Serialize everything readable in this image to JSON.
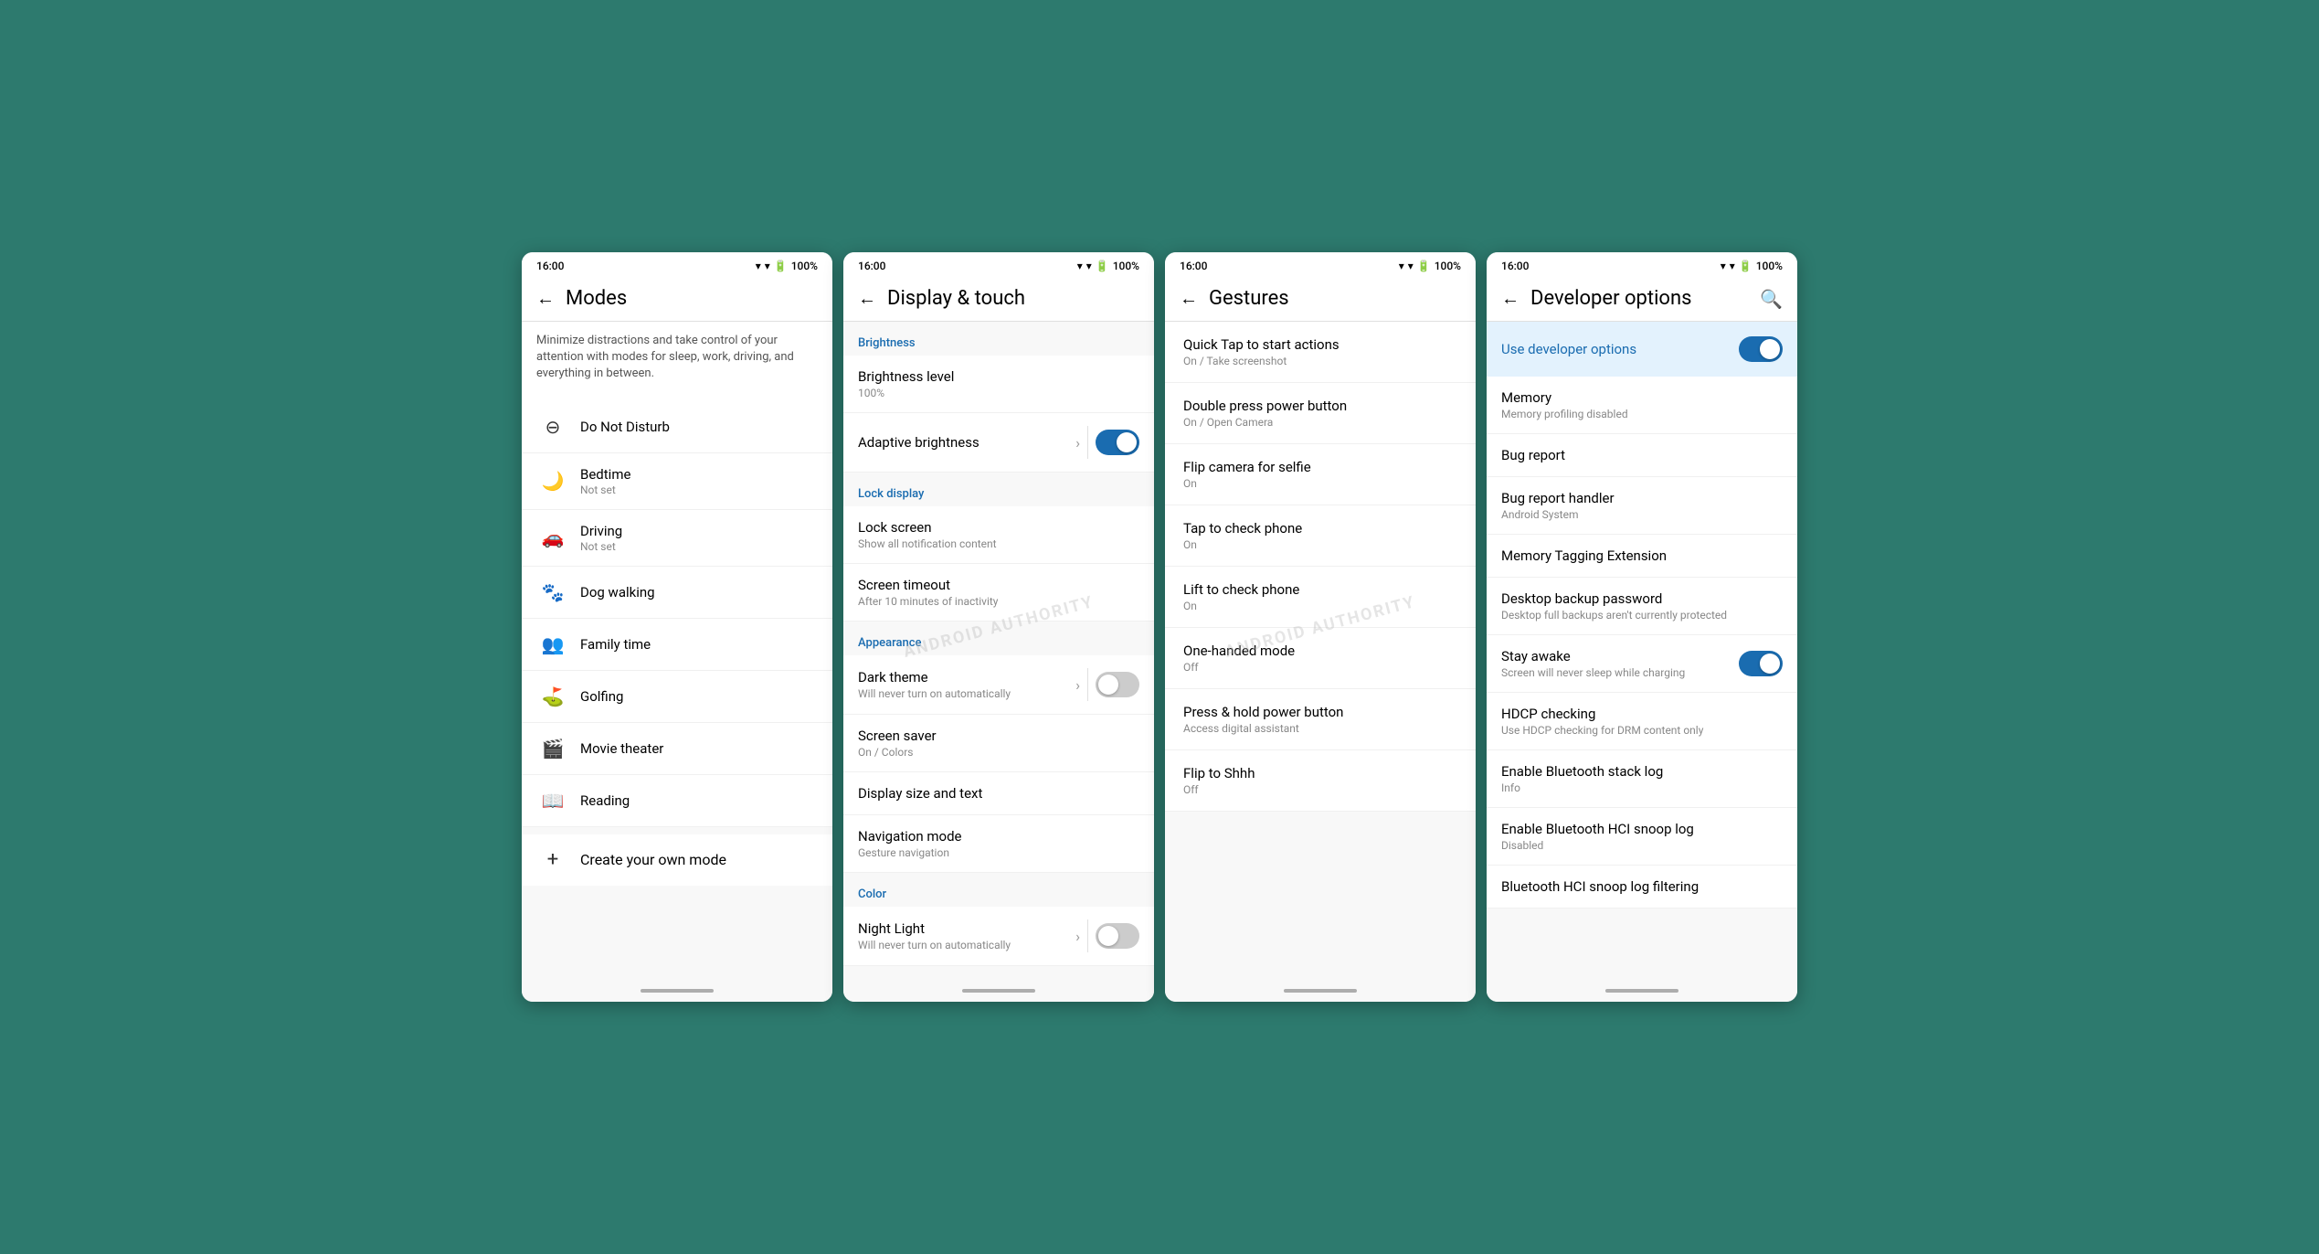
{
  "screens": [
    {
      "id": "modes",
      "statusBar": {
        "time": "16:00",
        "battery": "100%",
        "hasWifi": true,
        "hasBattery": true
      },
      "header": {
        "title": "Modes",
        "hasBack": true,
        "hasSearch": false
      },
      "description": "Minimize distractions and take control of your attention with modes for sleep, work, driving, and everything in between.",
      "modes": [
        {
          "icon": "⊖",
          "name": "Do Not Disturb",
          "sub": ""
        },
        {
          "icon": "🌙",
          "name": "Bedtime",
          "sub": "Not set"
        },
        {
          "icon": "🚗",
          "name": "Driving",
          "sub": "Not set"
        },
        {
          "icon": "🐾",
          "name": "Dog walking",
          "sub": ""
        },
        {
          "icon": "👥",
          "name": "Family time",
          "sub": ""
        },
        {
          "icon": "⛳",
          "name": "Golfing",
          "sub": ""
        },
        {
          "icon": "🎬",
          "name": "Movie theater",
          "sub": ""
        },
        {
          "icon": "📖",
          "name": "Reading",
          "sub": ""
        }
      ],
      "createMode": {
        "icon": "+",
        "label": "Create your own mode"
      }
    },
    {
      "id": "display-touch",
      "statusBar": {
        "time": "16:00",
        "battery": "100%",
        "hasWifi": true,
        "hasBattery": true
      },
      "header": {
        "title": "Display & touch",
        "hasBack": true
      },
      "sections": [
        {
          "label": "Brightness",
          "items": [
            {
              "name": "Brightness level",
              "sub": "100%",
              "hasToggle": false,
              "hasChevron": false,
              "toggleOn": false,
              "hasSlider": false
            },
            {
              "name": "Adaptive brightness",
              "sub": "",
              "hasToggle": true,
              "hasChevron": true,
              "toggleOn": true
            }
          ]
        },
        {
          "label": "Lock display",
          "items": [
            {
              "name": "Lock screen",
              "sub": "Show all notification content",
              "hasToggle": false,
              "hasChevron": false
            },
            {
              "name": "Screen timeout",
              "sub": "After 10 minutes of inactivity",
              "hasToggle": false,
              "hasChevron": false
            }
          ]
        },
        {
          "label": "Appearance",
          "items": [
            {
              "name": "Dark theme",
              "sub": "Will never turn on automatically",
              "hasToggle": true,
              "hasChevron": true,
              "toggleOn": false
            },
            {
              "name": "Screen saver",
              "sub": "On / Colors",
              "hasToggle": false,
              "hasChevron": false
            },
            {
              "name": "Display size and text",
              "sub": "",
              "hasToggle": false,
              "hasChevron": false
            },
            {
              "name": "Navigation mode",
              "sub": "Gesture navigation",
              "hasToggle": false,
              "hasChevron": false
            }
          ]
        },
        {
          "label": "Color",
          "items": [
            {
              "name": "Night Light",
              "sub": "Will never turn on automatically",
              "hasToggle": true,
              "hasChevron": true,
              "toggleOn": false
            }
          ]
        }
      ]
    },
    {
      "id": "gestures",
      "statusBar": {
        "time": "16:00",
        "battery": "100%",
        "hasWifi": true,
        "hasBattery": true
      },
      "header": {
        "title": "Gestures",
        "hasBack": true
      },
      "gestures": [
        {
          "name": "Quick Tap to start actions",
          "sub": "On / Take screenshot"
        },
        {
          "name": "Double press power button",
          "sub": "On / Open Camera"
        },
        {
          "name": "Flip camera for selfie",
          "sub": "On"
        },
        {
          "name": "Tap to check phone",
          "sub": "On"
        },
        {
          "name": "Lift to check phone",
          "sub": "On"
        },
        {
          "name": "One-handed mode",
          "sub": "Off"
        },
        {
          "name": "Press & hold power button",
          "sub": "Access digital assistant"
        },
        {
          "name": "Flip to Shhh",
          "sub": "Off"
        }
      ]
    },
    {
      "id": "developer-options",
      "statusBar": {
        "time": "16:00",
        "battery": "100%",
        "hasWifi": true,
        "hasBattery": true
      },
      "header": {
        "title": "Developer options",
        "hasBack": true,
        "hasSearch": true
      },
      "useDevLabel": "Use developer options",
      "useDevOn": true,
      "settings": [
        {
          "name": "Memory",
          "sub": "Memory profiling disabled",
          "hasToggle": false
        },
        {
          "name": "Bug report",
          "sub": "",
          "hasToggle": false
        },
        {
          "name": "Bug report handler",
          "sub": "Android System",
          "hasToggle": false
        },
        {
          "name": "Memory Tagging Extension",
          "sub": "",
          "hasToggle": false
        },
        {
          "name": "Desktop backup password",
          "sub": "Desktop full backups aren't currently protected",
          "hasToggle": false
        },
        {
          "name": "Stay awake",
          "sub": "Screen will never sleep while charging",
          "hasToggle": true,
          "toggleOn": true
        },
        {
          "name": "HDCP checking",
          "sub": "Use HDCP checking for DRM content only",
          "hasToggle": false
        },
        {
          "name": "Enable Bluetooth stack log",
          "sub": "Info",
          "hasToggle": false
        },
        {
          "name": "Enable Bluetooth HCI snoop log",
          "sub": "Disabled",
          "hasToggle": false
        },
        {
          "name": "Bluetooth HCI snoop log filtering",
          "sub": "",
          "hasToggle": false
        }
      ]
    }
  ]
}
